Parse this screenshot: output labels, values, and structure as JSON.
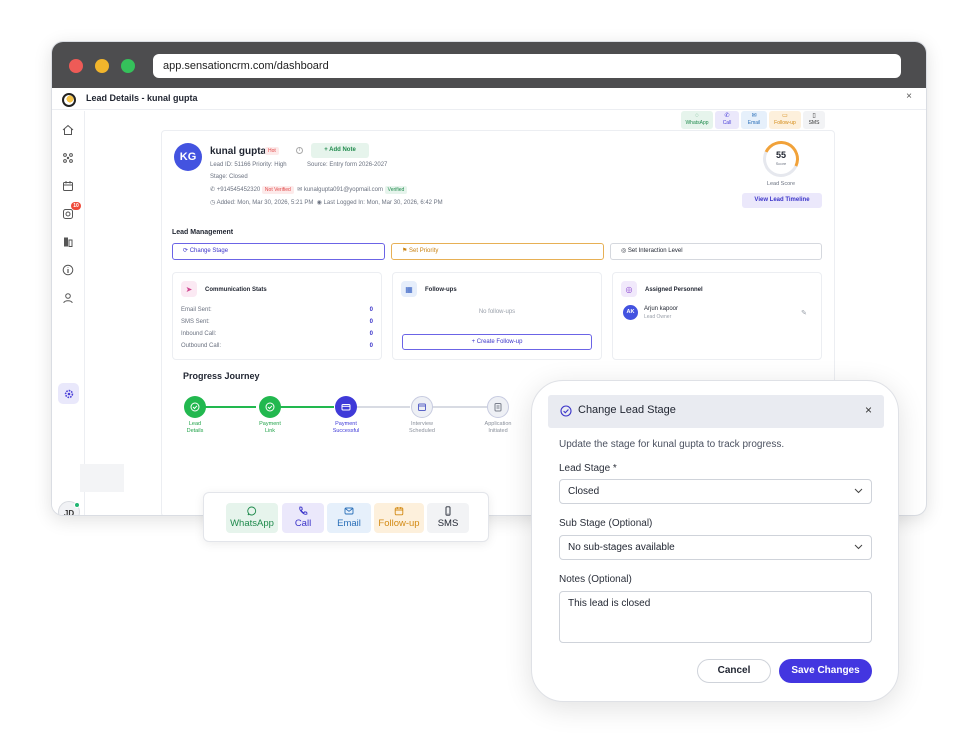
{
  "browser": {
    "url": "app.sensationcrm.com/dashboard"
  },
  "app": {
    "title": "Lead Details - kunal gupta",
    "close": "×"
  },
  "sidebar": {
    "notification_count": "10",
    "user_initials": "JD"
  },
  "top_actions": {
    "whatsapp": "WhatsApp",
    "call": "Call",
    "email": "Email",
    "followup": "Follow-up",
    "sms": "SMS"
  },
  "lead": {
    "initials": "KG",
    "name": "kunal gupta",
    "hot_tag": "Hot",
    "add_note": "+ Add Note",
    "lead_id_line": "Lead ID: 51166   Priority: High",
    "source": "Source: Entry form 2026-2027",
    "stage": "Stage: Closed",
    "phone": "+914545452320",
    "phone_status": "Not Verified",
    "email": "kunalgupta091@yopmail.com",
    "email_status": "Verified",
    "added": "Added: Mon, Mar 30, 2026, 5:21 PM",
    "last_logged": "Last Logged In: Mon, Mar 30, 2026, 6:42 PM",
    "score": "55",
    "score_label": "Score",
    "score_caption": "Lead Score",
    "timeline_button": "View Lead Timeline"
  },
  "lead_management": {
    "title": "Lead Management",
    "change_stage": "Change Stage",
    "set_priority": "Set Priority",
    "set_interaction": "Set Interaction Level"
  },
  "communication_stats": {
    "title": "Communication Stats",
    "rows": [
      {
        "label": "Email Sent:",
        "value": "0"
      },
      {
        "label": "SMS Sent:",
        "value": "0"
      },
      {
        "label": "Inbound Call:",
        "value": "0"
      },
      {
        "label": "Outbound Call:",
        "value": "0"
      }
    ]
  },
  "followups": {
    "title": "Follow-ups",
    "empty": "No follow-ups",
    "create": "+ Create Follow-up"
  },
  "assigned": {
    "title": "Assigned Personnel",
    "initials": "AK",
    "name": "Arjun kapoor",
    "role": "Lead Owner"
  },
  "journey": {
    "title": "Progress Journey",
    "steps": [
      {
        "line1": "Lead",
        "line2": "Details",
        "state": "done"
      },
      {
        "line1": "Payment",
        "line2": "Link",
        "state": "done"
      },
      {
        "line1": "Payment",
        "line2": "Successful",
        "state": "current"
      },
      {
        "line1": "Interview",
        "line2": "Scheduled",
        "state": "pending"
      },
      {
        "line1": "Application",
        "line2": "Initiated",
        "state": "pending"
      }
    ]
  },
  "quick_actions": {
    "whatsapp": "WhatsApp",
    "call": "Call",
    "email": "Email",
    "followup": "Follow-up",
    "sms": "SMS"
  },
  "modal": {
    "title": "Change Lead Stage",
    "close": "×",
    "description": "Update the stage for kunal gupta to track progress.",
    "lead_stage_label": "Lead Stage *",
    "lead_stage_value": "Closed",
    "sub_stage_label": "Sub Stage (Optional)",
    "sub_stage_value": "No sub-stages available",
    "notes_label": "Notes (Optional)",
    "notes_value": "This lead is closed",
    "cancel": "Cancel",
    "save": "Save Changes"
  },
  "colors": {
    "primary": "#4336e0",
    "success": "#22b84f",
    "whatsapp": "#1f8a4c",
    "followup": "#d38a14",
    "danger": "#e04545"
  }
}
